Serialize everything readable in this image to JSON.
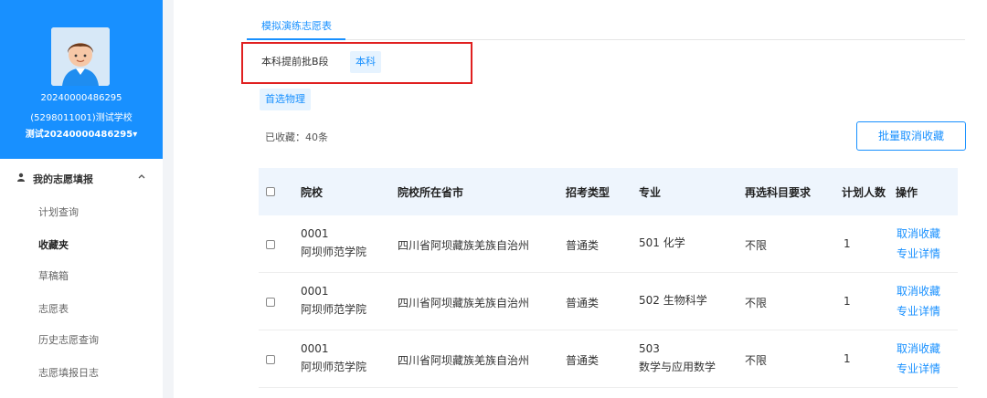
{
  "sidebar": {
    "user_id": "20240000486295",
    "school": "(5298011001)测试学校",
    "user_name": "测试20240000486295",
    "user_caret": "▾",
    "group_label": "我的志愿填报",
    "group_icon": "person-icon",
    "items": [
      {
        "label": "计划查询"
      },
      {
        "label": "收藏夹"
      },
      {
        "label": "草稿箱"
      },
      {
        "label": "志愿表"
      },
      {
        "label": "历史志愿查询"
      },
      {
        "label": "志愿填报日志"
      }
    ]
  },
  "tab": {
    "label": "模拟演练志愿表"
  },
  "filters": {
    "batch_plain": "本科提前批B段",
    "batch_selected": "本科",
    "subject": "首选物理"
  },
  "favorites_count": "已收藏：40条",
  "batch_cancel_label": "批量取消收藏",
  "table": {
    "headers": {
      "school": "院校",
      "location": "院校所在省市",
      "type": "招考类型",
      "major": "专业",
      "subjects": "再选科目要求",
      "plan": "计划人数",
      "ops": "操作"
    },
    "rows": [
      {
        "code": "0001",
        "school": "阿坝师范学院",
        "location": "四川省阿坝藏族羌族自治州",
        "type": "普通类",
        "major_l1": "501 化学",
        "major_l2": "",
        "subjects": "不限",
        "plan": "1",
        "op1": "取消收藏",
        "op2": "专业详情"
      },
      {
        "code": "0001",
        "school": "阿坝师范学院",
        "location": "四川省阿坝藏族羌族自治州",
        "type": "普通类",
        "major_l1": "502 生物科学",
        "major_l2": "",
        "subjects": "不限",
        "plan": "1",
        "op1": "取消收藏",
        "op2": "专业详情"
      },
      {
        "code": "0001",
        "school": "阿坝师范学院",
        "location": "四川省阿坝藏族羌族自治州",
        "type": "普通类",
        "major_l1": "503",
        "major_l2": "数学与应用数学",
        "subjects": "不限",
        "plan": "1",
        "op1": "取消收藏",
        "op2": "专业详情"
      }
    ]
  },
  "colors": {
    "accent": "#1890ff",
    "highlight": "#e02020"
  }
}
